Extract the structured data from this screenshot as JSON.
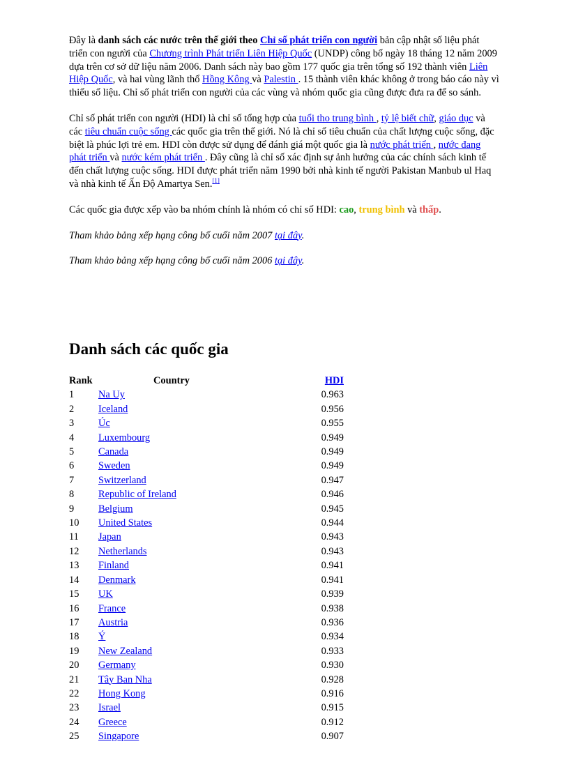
{
  "intro": {
    "p1": [
      "Đây là ",
      "danh  sách các nước trên thế giới theo",
      " ",
      "Chỉ số phát triển con người",
      " bản cập nhật số liệu  phát triển  con người  của ",
      "Chương trình  Phát triển  Liên Hiệp Quốc",
      " (UNDP) công bố ngày 18 tháng  12 năm  2009 dựa trên cơ sở dữ liệu  năm  2006. Danh  sách này bao gồm  177 quốc gia  trên tổng  số 192 thành  viên ",
      "Liên  Hiệp  Quốc",
      ", và hai  vùng  lãnh  thổ ",
      "Hồng  Kông ",
      " và ",
      "Palestin ",
      ". 15 thành  viên  khác không  ở trong  báo cáo này vì thiếu  số liệu.  Chỉ số phát triển  con người của các vùng  và nhóm  quốc gia  cũng  được đưa ra để so sánh."
    ],
    "p2": [
      "Chỉ số phát triển  con người  (HDI) là chỉ số tổng  hợp của ",
      "tuổi  tho trung  bình ",
      ", ",
      "tỷ lệ  biết chữ",
      ", ",
      "giáo  dục",
      " và các ",
      "tiêu  chuẩn  cuộc sống ",
      " các quốc gia  trên thế giới.  Nó là chỉ số tiêu  chuẩn  của chất lượng  cuộc sống,  đặc biệt là phúc lợi  trẻ em. HDI còn được sử dụng  để đánh giá  một quốc gia  là ",
      "nước phát triển ",
      ", ",
      "nước  đang phát triển ",
      " và ",
      "nước kém phát triển ",
      ". Đây cũng  là chỉ số xác định  sự ảnh hưởng  của các chính  sách kinh  tế đến chất lượng  cuộc sống. HDI được phát triển  năm  1990 bởi nhà kinh tế người  Pakistan  Manbub ul Haq và nhà kinh  tế Ấn Độ Amartya  Sen.",
      "[1]"
    ],
    "p3": [
      "Các quốc gia  được xếp vào ba nhóm  chính  là nhóm  có chỉ số HDI:  ",
      "cao",
      ", ",
      "trung  bình",
      " và ",
      "thấp",
      "."
    ],
    "p4": [
      "Tham khảo bảng xếp hạng công bố cuối năm 2007 ",
      "tại đây",
      "."
    ],
    "p5": [
      "Tham khảo bảng xếp hạng công bố cuối năm 2006 ",
      "tại đây",
      "."
    ]
  },
  "colors": {
    "high": "#1a9a1a",
    "medium": "#f0c000",
    "low": "#e05050",
    "link": "#0000ee"
  },
  "section_title": "Danh sách các quốc gia",
  "table": {
    "headers": {
      "rank": "Rank",
      "country": "Country",
      "hdi": "HDI"
    },
    "rows": [
      [
        "1",
        "Na Uy",
        "0.963"
      ],
      [
        "2",
        "Iceland ",
        "0.956"
      ],
      [
        "3",
        "Úc",
        "0.955"
      ],
      [
        "4",
        "Luxembourg ",
        "0.949"
      ],
      [
        "5",
        "Canada",
        "0.949"
      ],
      [
        "6",
        "Sweden ",
        "0.949"
      ],
      [
        "7",
        "Switzerland ",
        "0.947"
      ],
      [
        "8",
        "Republic  of Ireland ",
        "0.946"
      ],
      [
        "9",
        "Belgium ",
        "0.945"
      ],
      [
        "10",
        "United  States",
        "0.944"
      ],
      [
        "11",
        "Japan ",
        "0.943"
      ],
      [
        "12",
        "Netherlands ",
        "0.943"
      ],
      [
        "13",
        "Finland ",
        "0.941"
      ],
      [
        "14",
        "Denmark ",
        "0.941"
      ],
      [
        "15",
        "UK",
        "0.939"
      ],
      [
        "16",
        "France ",
        "0.938"
      ],
      [
        "17",
        "Austria ",
        "0.936"
      ],
      [
        "18",
        "Ý",
        "0.934"
      ],
      [
        "19",
        "New Zealand ",
        "0.933"
      ],
      [
        "20",
        "Germany ",
        "0.930"
      ],
      [
        "21",
        "Tây Ban Nha",
        "0.928"
      ],
      [
        "22",
        "Hong  Kong ",
        "0.916"
      ],
      [
        "23",
        "Israel ",
        "0.915"
      ],
      [
        "24",
        "Greece ",
        "0.912"
      ],
      [
        "25",
        "Singapore ",
        "0.907"
      ]
    ]
  }
}
